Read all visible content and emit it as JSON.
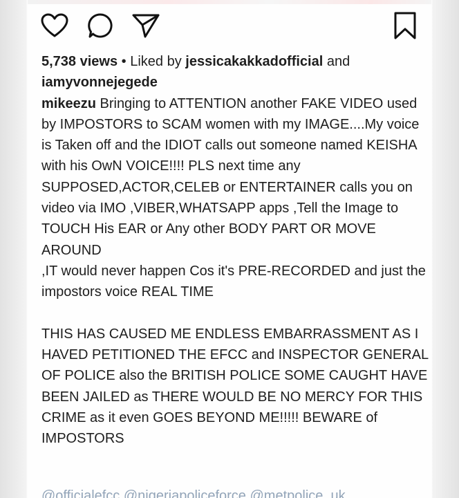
{
  "post": {
    "views": "5,738 views",
    "liked_by_prefix": " • Liked by ",
    "liker_1": "jessicakakkadofficial",
    "liked_and": " and",
    "liker_2": "iamyvonnejegede",
    "author": "mikeezu",
    "caption": " Bringing to ATTENTION another FAKE VIDEO used by IMPOSTORS to SCAM women with my IMAGE....My voice is Taken off and the IDIOT calls out someone named KEISHA with his OwN VOICE!!!! PLS next time any SUPPOSED,ACTOR,CELEB or ENTERTAINER calls you on video via IMO ,VIBER,WHATSAPP apps ,Tell the Image to TOUCH His EAR or Any other BODY PART OR MOVE AROUND\n,IT would never happen Cos it's PRE-RECORDED and just the impostors voice REAL TIME\n\nTHIS HAS CAUSED ME ENDLESS EMBARRASSMENT AS I HAVED PETITIONED THE EFCC and INSPECTOR GENERAL OF POLICE also the BRITISH POLICE SOME CAUGHT HAVE BEEN JAILED as THERE WOULD BE NO MERCY FOR THIS CRIME as it even GOES BEYOND ME!!!!! BEWARE of IMPOSTORS",
    "tags_partial": "@officialefcc @nigeriapoliceforce @metpolice_uk"
  },
  "actions": {
    "like_icon": "heart-icon",
    "comment_icon": "comment-icon",
    "share_icon": "send-icon",
    "save_icon": "bookmark-icon"
  }
}
